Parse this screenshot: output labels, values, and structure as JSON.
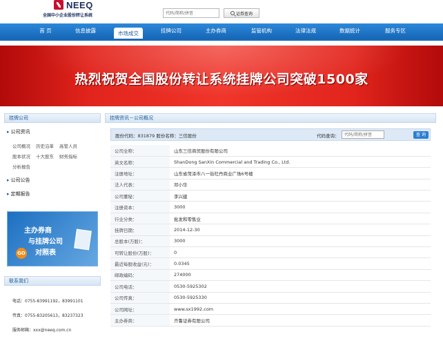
{
  "header": {
    "logo_name": "NEEQ",
    "logo_subtitle": "全国中小企业股份转让系统",
    "top_links": "",
    "search_placeholder": "代码/简称/拼音",
    "search_button": "证券查询"
  },
  "nav": {
    "items": [
      {
        "label": "首 页"
      },
      {
        "label": "信息披露"
      },
      {
        "label": "市场成交"
      },
      {
        "label": "挂牌公司"
      },
      {
        "label": "主办券商"
      },
      {
        "label": "监管机构"
      },
      {
        "label": "法律法规"
      },
      {
        "label": "数据统计"
      },
      {
        "label": "服务专区"
      }
    ],
    "active_index": 2
  },
  "banner": {
    "text": "热烈祝贺全国股份转让系统挂牌公司突破1500家"
  },
  "sidebar": {
    "title": "挂牌公司",
    "sections": [
      {
        "label": "公司资讯"
      },
      {
        "label": "公司公告"
      },
      {
        "label": "定期报告"
      }
    ],
    "links": [
      "公司概况",
      "历史沿革",
      "高管人员",
      "股本状况",
      "十大股东",
      "财务指标",
      "分析报告"
    ],
    "promo": {
      "line1": "主办券商",
      "line2": "与挂牌公司",
      "line3": "对照表",
      "badge": "GO"
    },
    "contact": {
      "title": "联系我们",
      "phone": "电话：0755-83991192，83991101",
      "fax": "传真：0755-83205613，83237323",
      "email": "服务邮箱：xxx@neeq.com.cn"
    }
  },
  "main": {
    "breadcrumb": "挂牌资讯－公司概况",
    "code_label": "股份代码：831879  股份名称：三信股份",
    "query_label": "代码查询：",
    "query_placeholder": "代码/简称/拼音",
    "query_button": "查 询",
    "rows": [
      {
        "key": "公司全称：",
        "value": "山东三信商贸股份有限公司"
      },
      {
        "key": "英文名称：",
        "value": "ShanDong SanXin Commercial and Trading Co., Ltd."
      },
      {
        "key": "注册地址：",
        "value": "山东省菏泽市八一街社丹商业广场6号楼"
      },
      {
        "key": "法人代表：",
        "value": "邓小华"
      },
      {
        "key": "公司董秘：",
        "value": "李兴建"
      },
      {
        "key": "注册资本：",
        "value": "3000"
      },
      {
        "key": "行业分类：",
        "value": "批发和零售业"
      },
      {
        "key": "挂牌日期：",
        "value": "2014-12-30"
      },
      {
        "key": "总股本(万股)：",
        "value": "3000"
      },
      {
        "key": "可转让股份(万股)：",
        "value": "0"
      },
      {
        "key": "最近每股收益(元)：",
        "value": "0.0345"
      },
      {
        "key": "邮政编码：",
        "value": "274000"
      },
      {
        "key": "公司电话：",
        "value": "0530-5925302"
      },
      {
        "key": "公司传真：",
        "value": "0530-5925330"
      },
      {
        "key": "公司网址：",
        "value": "www.sx1992.com"
      },
      {
        "key": "主办券商：",
        "value": "齐鲁证券有限公司"
      }
    ]
  },
  "colors": {
    "nav_blue": "#1767b7",
    "banner_red": "#e1241c",
    "panel_blue": "#1e5b9a",
    "logo_red": "#c8102e"
  }
}
